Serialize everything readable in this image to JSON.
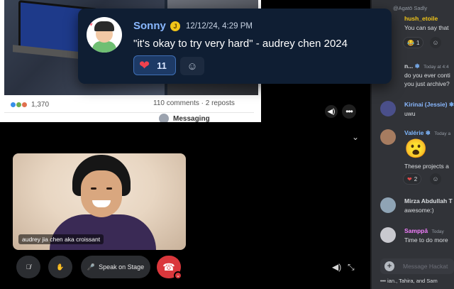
{
  "screen_share": {
    "reactions_count": "1,370",
    "comments_reposts": "110 comments · 2 reposts",
    "messaging_label": "Messaging"
  },
  "video": {
    "participant_label": "audrey jia chen aka croissant"
  },
  "controls": {
    "speak_on_stage": "Speak on Stage"
  },
  "popup": {
    "author": "Sonny",
    "badge": "J",
    "timestamp": "12/12/24, 4:29 PM",
    "message": "\"it's okay to try very hard\" - audrey chen 2024",
    "reaction_count": "11"
  },
  "chat": {
    "messages": [
      {
        "author": "@Agatō",
        "author_color": "#949ba4",
        "text": "Sadly"
      },
      {
        "author": "hush_etoile",
        "author_color": "#f0c419",
        "text": "You can say that"
      },
      {
        "reaction_count": "1"
      },
      {
        "author": "n...",
        "author_color": "#dbdee1",
        "time": "Today at 4:4",
        "text": "do you ever conti"
      },
      {
        "text": "you just archive?"
      },
      {
        "author": "Kirinai (Jessie)",
        "author_color": "#89b8ff",
        "text": "uwu"
      },
      {
        "author": "Valérie",
        "author_color": "#7fb8ff",
        "time": "Today a",
        "text": "These projects a"
      },
      {
        "reaction_count": "2"
      },
      {
        "author": "Mirza Abdullah T",
        "author_color": "#dbdee1",
        "text": "awesome:)"
      },
      {
        "author": "Samppā",
        "author_color": "#f47fff",
        "time": "Today",
        "text": "Time to do more"
      }
    ],
    "input_placeholder": "Message Hackat",
    "typing": "ian., Tahira, and Sam"
  }
}
